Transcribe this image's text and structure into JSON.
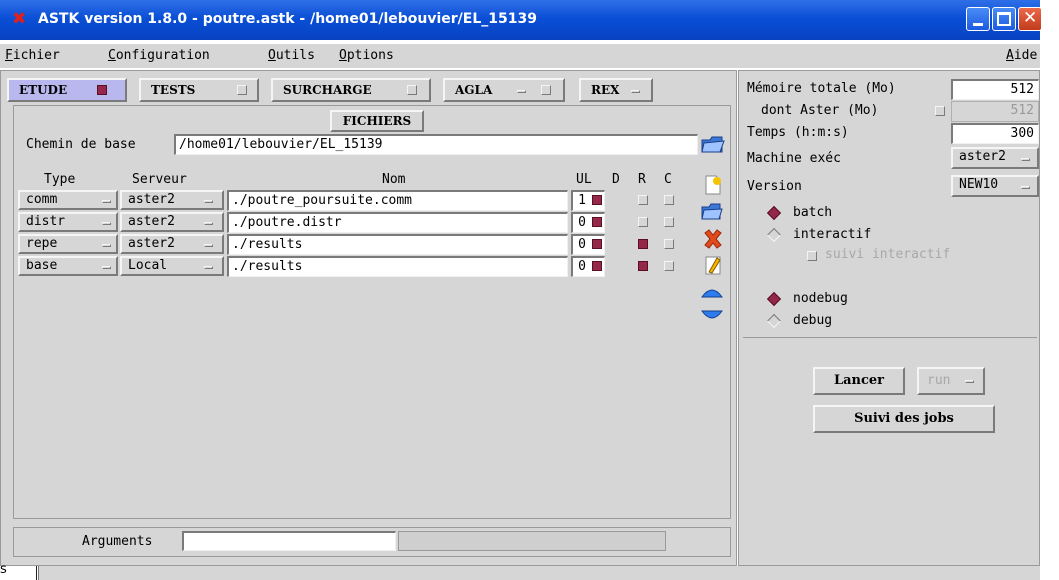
{
  "window": {
    "title": "ASTK version 1.8.0 - poutre.astk - /home01/lebouvier/EL_15139"
  },
  "menu": {
    "fichier": {
      "key": "F",
      "rest": "ichier"
    },
    "configuration": {
      "key": "C",
      "rest": "onfiguration"
    },
    "outils": {
      "key": "O",
      "rest": "utils"
    },
    "options": {
      "key": "O",
      "rest": "ptions"
    },
    "aide": {
      "key": "A",
      "rest": "ide"
    }
  },
  "tabs": [
    "ETUDE",
    "TESTS",
    "SURCHARGE",
    "AGLA",
    "REX"
  ],
  "files": {
    "header": "FICHIERS",
    "chemin_label": "Chemin de base",
    "chemin_value": "/home01/lebouvier/EL_15139",
    "columns": {
      "type": "Type",
      "serveur": "Serveur",
      "nom": "Nom",
      "ul": "UL",
      "d": "D",
      "r": "R",
      "c": "C"
    },
    "rows": [
      {
        "type": "comm",
        "serveur": "aster2",
        "nom": "./poutre_poursuite.comm",
        "ul": "1",
        "d": true,
        "r": false,
        "c": false
      },
      {
        "type": "distr",
        "serveur": "aster2",
        "nom": "./poutre.distr",
        "ul": "0",
        "d": true,
        "r": false,
        "c": false
      },
      {
        "type": "repe",
        "serveur": "aster2",
        "nom": "./results",
        "ul": "0",
        "d": true,
        "r": true,
        "c": false
      },
      {
        "type": "base",
        "serveur": "Local",
        "nom": "./results",
        "ul": "0",
        "d": true,
        "r": true,
        "c": false
      }
    ]
  },
  "arguments": {
    "label": "Arguments",
    "value": ""
  },
  "settings": {
    "memoire_label": "Mémoire totale (Mo)",
    "memoire_value": "512",
    "aster_label": "dont Aster (Mo)",
    "aster_value": "512",
    "temps_label": "Temps (h:m:s)",
    "temps_value": "300",
    "machine_label": "Machine exéc",
    "machine_value": "aster2",
    "version_label": "Version",
    "version_value": "NEW10",
    "batch": "batch",
    "interactif": "interactif",
    "suivi_interactif": "suivi interactif",
    "nodebug": "nodebug",
    "debug": "debug"
  },
  "actions": {
    "lancer": "Lancer",
    "run": "run",
    "suivi": "Suivi des jobs"
  },
  "statusbar": {
    "text": "s"
  },
  "colors": {
    "accent": "#93284a",
    "title_bar": "#0a4fd6",
    "panel": "#d6d6d6"
  }
}
